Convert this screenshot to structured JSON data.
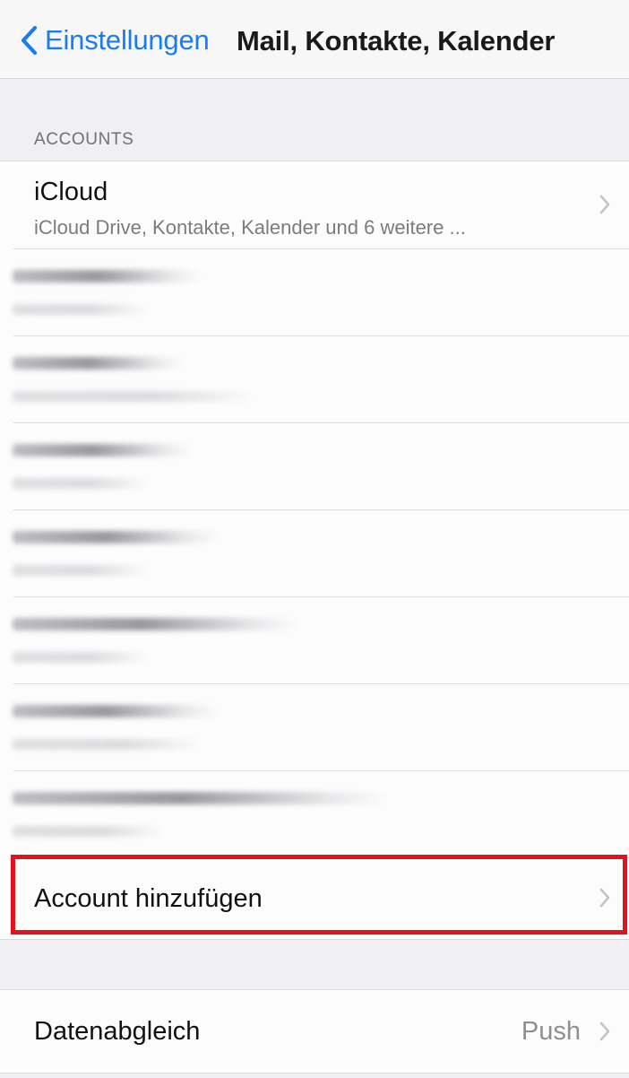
{
  "navbar": {
    "back_label": "Einstellungen",
    "title": "Mail, Kontakte, Kalender"
  },
  "accounts_section": {
    "header": "ACCOUNTS",
    "icloud": {
      "title": "iCloud",
      "subtitle": "iCloud Drive, Kontakte, Kalender und 6 weitere ..."
    },
    "redacted_accounts_count": 7,
    "add_account_label": "Account hinzufügen"
  },
  "sync_section": {
    "label": "Datenabgleich",
    "value": "Push"
  },
  "colors": {
    "accent": "#1a7bf2",
    "highlight": "#e3121c",
    "background": "#efeff4"
  }
}
